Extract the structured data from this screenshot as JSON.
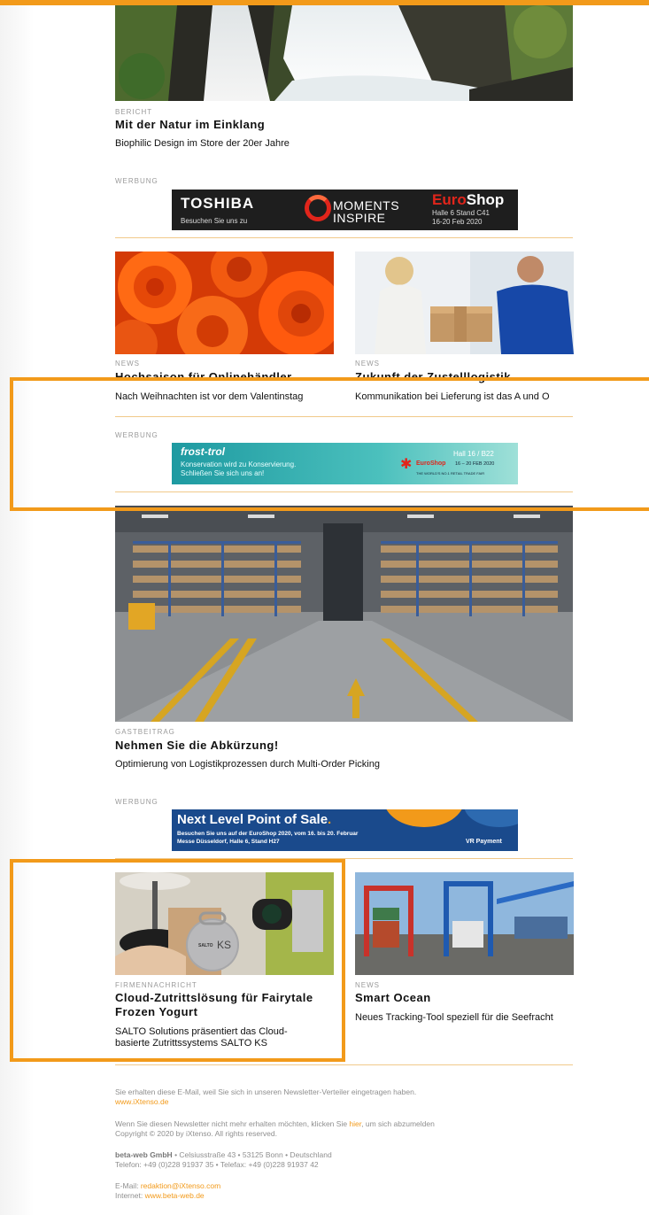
{
  "articles": [
    {
      "kicker": "BERICHT",
      "title": "Mit der Natur im Einklang",
      "sub": "Biophilic Design im Store der 20er Jahre"
    },
    {
      "kicker": "NEWS",
      "title": "Hochsaison für Onlinehändler",
      "sub": "Nach Weihnachten ist vor dem Valentinstag"
    },
    {
      "kicker": "NEWS",
      "title": "Zukunft der Zustelllogistik",
      "sub": "Kommunikation bei Lieferung ist das A und O"
    },
    {
      "kicker": "GASTBEITRAG",
      "title": "Nehmen Sie die Abkürzung!",
      "sub": "Optimierung von Logistikprozessen durch Multi-Order Picking"
    },
    {
      "kicker": "FIRMENNACHRICHT",
      "title_line1": "Cloud-Zutrittslösung für Fairytale",
      "title_line2": "Frozen Yogurt",
      "sub_line1": "SALTO Solutions präsentiert das Cloud-",
      "sub_line2": "basierte Zutrittssystems SALTO KS"
    },
    {
      "kicker": "NEWS",
      "title": "Smart Ocean",
      "sub": "Neues Tracking-Tool speziell für die Seefracht"
    }
  ],
  "ads": {
    "label": "WERBUNG",
    "toshiba": {
      "brand": "TOSHIBA",
      "tagline": "Besuchen Sie uns zu",
      "moments1": "MOMENTS",
      "moments2": "INSPIRE",
      "euro": "Euro",
      "shop": "Shop",
      "hall": "Halle 6 Stand C41",
      "dates": "16-20 Feb 2020"
    },
    "frost": {
      "brand": "frost-trol",
      "line1": "Konservation wird zu Konservierung.",
      "line2": "Schließen Sie sich uns an!",
      "hall": "Hall 16 / B22",
      "euroshop": "EuroShop",
      "dates": "16 – 20 FEB 2020",
      "fair": "THE WORLD'S NO.1 RETAIL TRADE FAIR"
    },
    "vr": {
      "headline": "Next Level Point of Sale",
      "dot": ".",
      "line1": "Besuchen Sie uns auf der EuroShop 2020, vom 16. bis 20. Februar",
      "line2": "Messe Düsseldorf, Halle 6, Stand H27",
      "brand": "VR Payment"
    }
  },
  "salto_tag": {
    "brand": "SALTO",
    "model": "KS"
  },
  "footer": {
    "p1": "Sie erhalten diese E-Mail, weil Sie sich in unseren Newsletter-Verteiler eingetragen haben.",
    "site": "www.iXtenso.de",
    "p2a": "Wenn Sie diesen Newsletter nicht mehr erhalten möchten, klicken Sie ",
    "p2link": "hier",
    "p2b": ", um sich abzumelden",
    "copy": "Copyright © 2020 by iXtenso. All rights reserved.",
    "company": "beta-web GmbH",
    "address": " • Celsiusstraße 43 • 53125 Bonn • Deutschland",
    "phone": "Telefon: +49 (0)228 91937 35 • Telefax: +49 (0)228 91937 42",
    "email_label": "E-Mail: ",
    "email": "redaktion@iXtenso.com",
    "internet_label": "Internet: ",
    "internet": "www.beta-web.de"
  },
  "colors": {
    "accent": "#f29a1a",
    "rule": "#f1c98a"
  }
}
